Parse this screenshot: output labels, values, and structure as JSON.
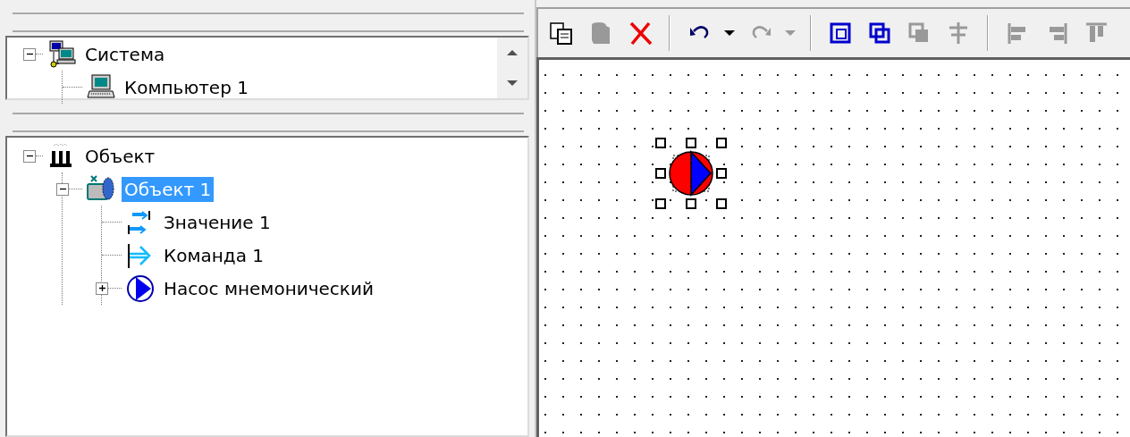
{
  "system_tree": {
    "items": [
      {
        "label": "Система",
        "kind": "network",
        "selected": false,
        "expanded": true,
        "children": [
          {
            "label": "Компьютер 1",
            "kind": "computer",
            "selected": false
          }
        ]
      }
    ]
  },
  "object_tree": {
    "items": [
      {
        "label": "Объект",
        "kind": "plant",
        "selected": false,
        "expanded": true,
        "children": [
          {
            "label": "Объект 1",
            "kind": "object",
            "selected": true,
            "expanded": true,
            "children": [
              {
                "label": "Значение 1",
                "kind": "value",
                "selected": false
              },
              {
                "label": "Команда 1",
                "kind": "command",
                "selected": false
              },
              {
                "label": "Насос мнемонический",
                "kind": "pump",
                "selected": false,
                "expanded": false
              }
            ]
          }
        ]
      }
    ]
  },
  "toolbar": [
    {
      "kind": "copy",
      "disabled": false
    },
    {
      "kind": "paste",
      "disabled": true
    },
    {
      "kind": "delete",
      "disabled": false
    },
    {
      "kind": "separator"
    },
    {
      "kind": "undo",
      "disabled": false
    },
    {
      "kind": "dropdown",
      "disabled": false
    },
    {
      "kind": "redo",
      "disabled": true
    },
    {
      "kind": "dropdown",
      "disabled": true
    },
    {
      "kind": "separator"
    },
    {
      "kind": "group",
      "disabled": false
    },
    {
      "kind": "ungroup",
      "disabled": false
    },
    {
      "kind": "bring-front",
      "disabled": true
    },
    {
      "kind": "send-back",
      "disabled": true
    },
    {
      "kind": "separator"
    },
    {
      "kind": "align-left",
      "disabled": true
    },
    {
      "kind": "align-right",
      "disabled": true
    },
    {
      "kind": "align-top",
      "disabled": true
    }
  ],
  "canvas": {
    "elements": [
      {
        "kind": "pump",
        "selected": true
      }
    ]
  }
}
